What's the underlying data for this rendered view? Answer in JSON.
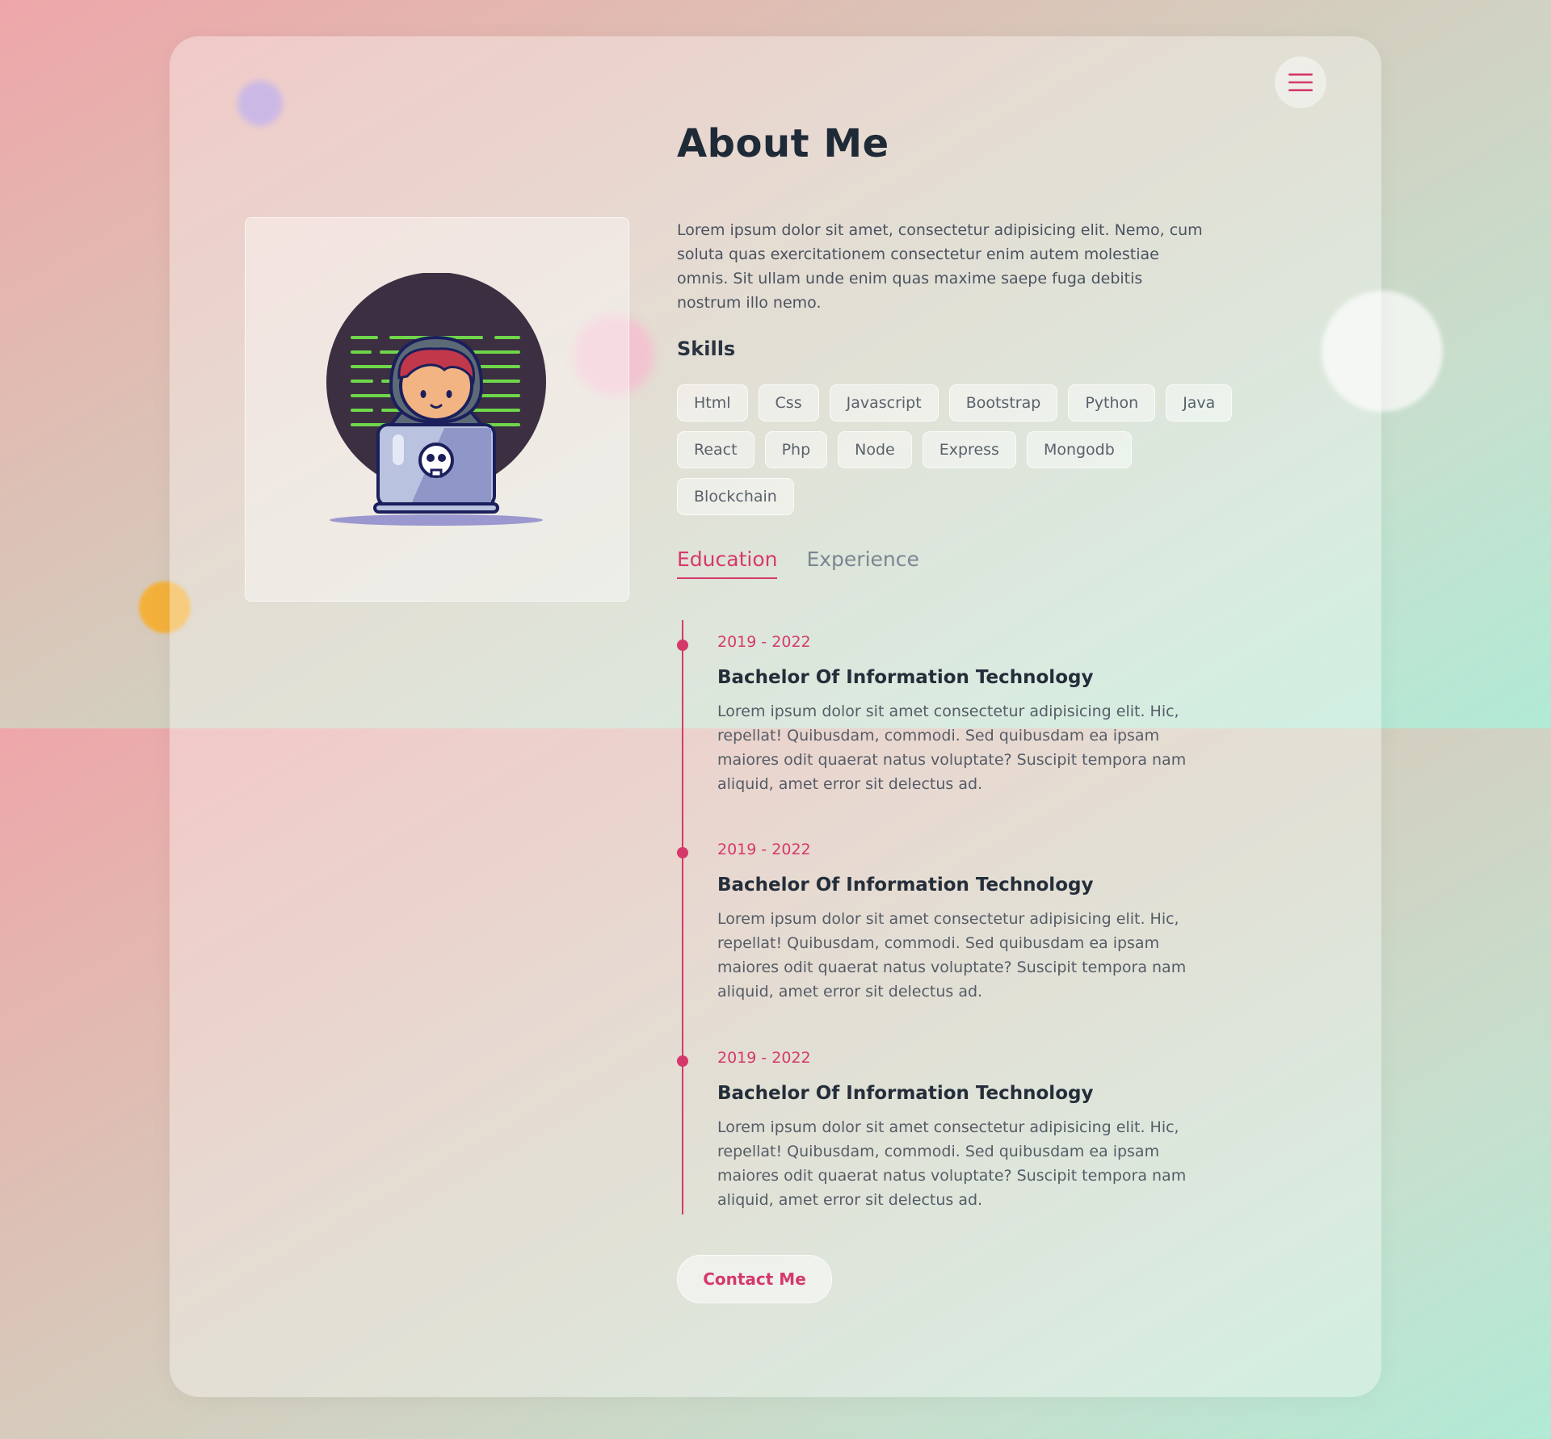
{
  "page": {
    "title": "About Me"
  },
  "menu": {
    "icon": "hamburger-menu-icon"
  },
  "avatar": {
    "icon": "hacker-laptop-illustration"
  },
  "intro": "Lorem ipsum dolor sit amet, consectetur adipisicing elit. Nemo, cum soluta quas exercitationem consectetur enim autem molestiae omnis. Sit ullam unde enim quas maxime saepe fuga debitis nostrum illo nemo.",
  "skills": {
    "title": "Skills",
    "items": [
      "Html",
      "Css",
      "Javascript",
      "Bootstrap",
      "Python",
      "Java",
      "React",
      "Php",
      "Node",
      "Express",
      "Mongodb",
      "Blockchain"
    ]
  },
  "tabs": [
    {
      "label": "Education",
      "active": true
    },
    {
      "label": "Experience",
      "active": false
    }
  ],
  "timeline": [
    {
      "date": "2019 - 2022",
      "title": "Bachelor Of Information Technology",
      "desc": "Lorem ipsum dolor sit amet consectetur adipisicing elit. Hic, repellat! Quibusdam, commodi. Sed quibusdam ea ipsam maiores odit quaerat natus voluptate? Suscipit tempora nam aliquid, amet error sit delectus ad."
    },
    {
      "date": "2019 - 2022",
      "title": "Bachelor Of Information Technology",
      "desc": "Lorem ipsum dolor sit amet consectetur adipisicing elit. Hic, repellat! Quibusdam, commodi. Sed quibusdam ea ipsam maiores odit quaerat natus voluptate? Suscipit tempora nam aliquid, amet error sit delectus ad."
    },
    {
      "date": "2019 - 2022",
      "title": "Bachelor Of Information Technology",
      "desc": "Lorem ipsum dolor sit amet consectetur adipisicing elit. Hic, repellat! Quibusdam, commodi. Sed quibusdam ea ipsam maiores odit quaerat natus voluptate? Suscipit tempora nam aliquid, amet error sit delectus ad."
    }
  ],
  "contact": {
    "label": "Contact Me"
  },
  "colors": {
    "accent": "#d5396b",
    "heading": "#1f2a37",
    "text": "#4b5360"
  }
}
